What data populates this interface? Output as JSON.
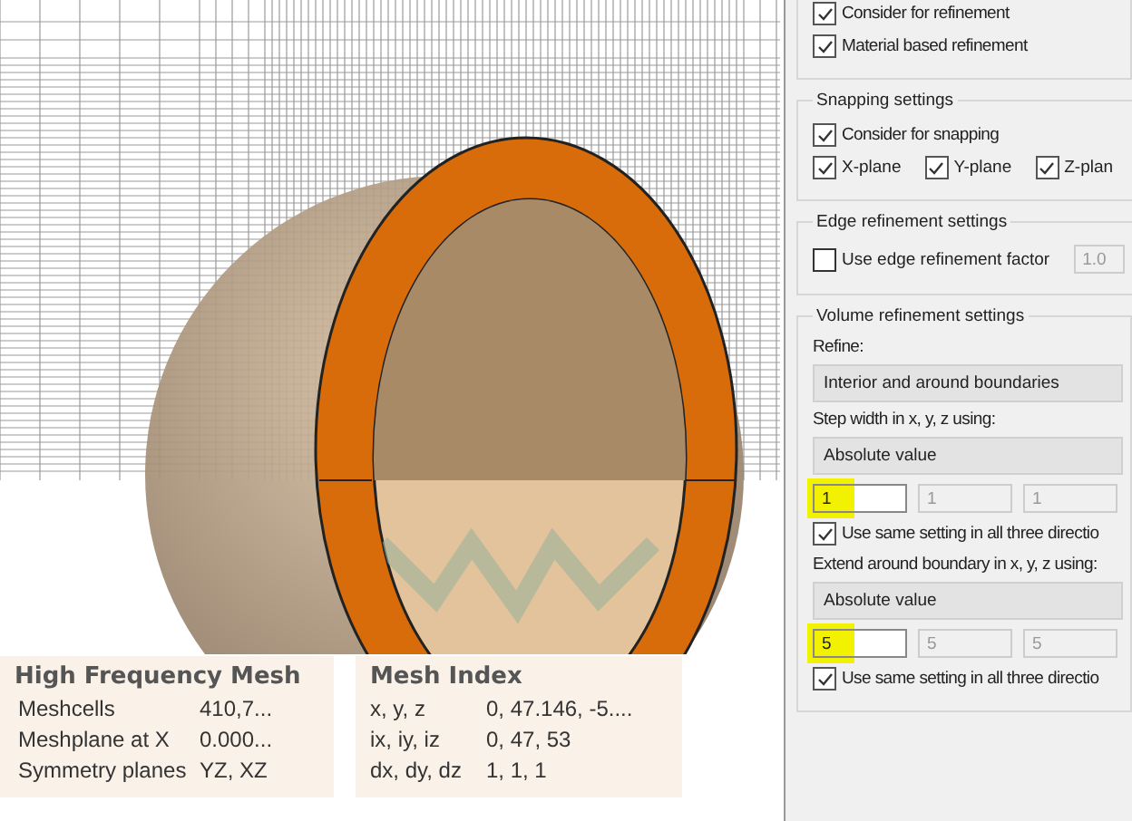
{
  "viewport": {
    "info_panels": [
      {
        "title": "High Frequency Mesh",
        "rows": [
          [
            "Meshcells",
            "410,7..."
          ],
          [
            "Meshplane at X",
            "0.000..."
          ],
          [
            "Symmetry planes",
            "YZ, XZ"
          ]
        ]
      },
      {
        "title": "Mesh Index",
        "rows": [
          [
            "x, y, z",
            "0, 47.146, -5...."
          ],
          [
            "ix, iy, iz",
            "0, 47, 53"
          ],
          [
            "dx, dy, dz",
            "1, 1, 1"
          ]
        ]
      }
    ]
  },
  "dialog": {
    "groups": [
      {
        "items": [
          {
            "kind": "checkbox",
            "label": "Consider for refinement",
            "checked": true
          },
          {
            "kind": "checkbox",
            "label": "Material based refinement",
            "checked": true
          }
        ]
      },
      {
        "title": "Snapping settings",
        "items": [
          {
            "kind": "checkbox",
            "label": "Consider for snapping",
            "checked": true
          },
          {
            "kind": "checkrow",
            "boxes": [
              {
                "label": "X-plane",
                "checked": true
              },
              {
                "label": "Y-plane",
                "checked": true
              },
              {
                "label": "Z-plan",
                "checked": true
              }
            ]
          }
        ]
      },
      {
        "title": "Edge refinement settings",
        "items": [
          {
            "kind": "checkfield",
            "label": "Use edge refinement factor",
            "checked": false,
            "value": "1.0",
            "disabled": true
          }
        ]
      },
      {
        "title": "Volume refinement settings",
        "items": [
          {
            "kind": "label",
            "text": "Refine:"
          },
          {
            "kind": "dropdown",
            "value": "Interior and around boundaries"
          },
          {
            "kind": "label",
            "text": "Step width in x, y, z using:"
          },
          {
            "kind": "dropdown",
            "value": "Absolute value"
          },
          {
            "kind": "fields",
            "fields": [
              {
                "value": "1",
                "disabled": false,
                "highlighted": true
              },
              {
                "value": "1",
                "disabled": true,
                "highlighted": false
              },
              {
                "value": "1",
                "disabled": true,
                "highlighted": false
              }
            ]
          },
          {
            "kind": "checkbox",
            "label": "Use same setting in all three directio",
            "checked": true
          },
          {
            "kind": "label",
            "text": "Extend around boundary in x, y, z using:"
          },
          {
            "kind": "dropdown",
            "value": "Absolute value"
          },
          {
            "kind": "fields",
            "fields": [
              {
                "value": "5",
                "disabled": false,
                "highlighted": true
              },
              {
                "value": "5",
                "disabled": true,
                "highlighted": false
              },
              {
                "value": "5",
                "disabled": true,
                "highlighted": false
              }
            ]
          },
          {
            "kind": "checkbox",
            "label": "Use same setting in all three directio",
            "checked": true
          }
        ]
      }
    ]
  }
}
